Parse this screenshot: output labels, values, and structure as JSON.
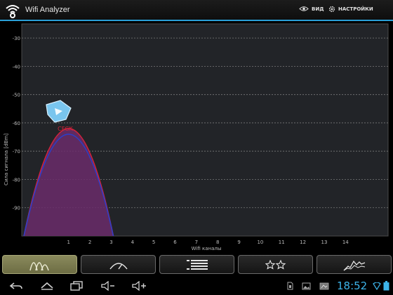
{
  "app": {
    "title": "Wifi Analyzer",
    "icon": "wifi-icon"
  },
  "actions": {
    "view": "ВИД",
    "settings": "НАСТРОЙКИ"
  },
  "colors": {
    "accent": "#2a9fd6",
    "clock": "#3db4ea",
    "active_tab": "#7d7d50"
  },
  "chart_data": {
    "type": "area",
    "ylabel": "Сила сигнала [dBm]",
    "xlabel": "Wifi каналы",
    "y_ticks": [
      "-30",
      "-40",
      "-50",
      "-60",
      "-70",
      "-80",
      "-90"
    ],
    "x_ticks": [
      "1",
      "2",
      "3",
      "4",
      "5",
      "6",
      "7",
      "8",
      "9",
      "10",
      "11",
      "12",
      "13",
      "14"
    ],
    "ylim": [
      -100,
      -25
    ],
    "xlim": [
      -1.2,
      16
    ],
    "grid": true,
    "series": [
      {
        "name": "",
        "channel": 1,
        "peak_dbm": -62,
        "color": "#d4223a",
        "fill": "#6a2b6a"
      },
      {
        "name": "",
        "channel": 1,
        "peak_dbm": -64,
        "color": "#2c3ec8",
        "fill": "none"
      }
    ],
    "annotations": [
      {
        "text": "CFGK",
        "color": "#d4223a"
      }
    ]
  },
  "tabs": [
    {
      "name": "channel-graph",
      "icon": "channel-graph-icon",
      "active": true
    },
    {
      "name": "signal-meter",
      "icon": "signal-meter-icon",
      "active": false
    },
    {
      "name": "ap-list",
      "icon": "list-icon",
      "active": false
    },
    {
      "name": "channel-rating",
      "icon": "stars-icon",
      "active": false
    },
    {
      "name": "time-graph",
      "icon": "time-graph-icon",
      "active": false
    }
  ],
  "status": {
    "time": "18:52"
  }
}
